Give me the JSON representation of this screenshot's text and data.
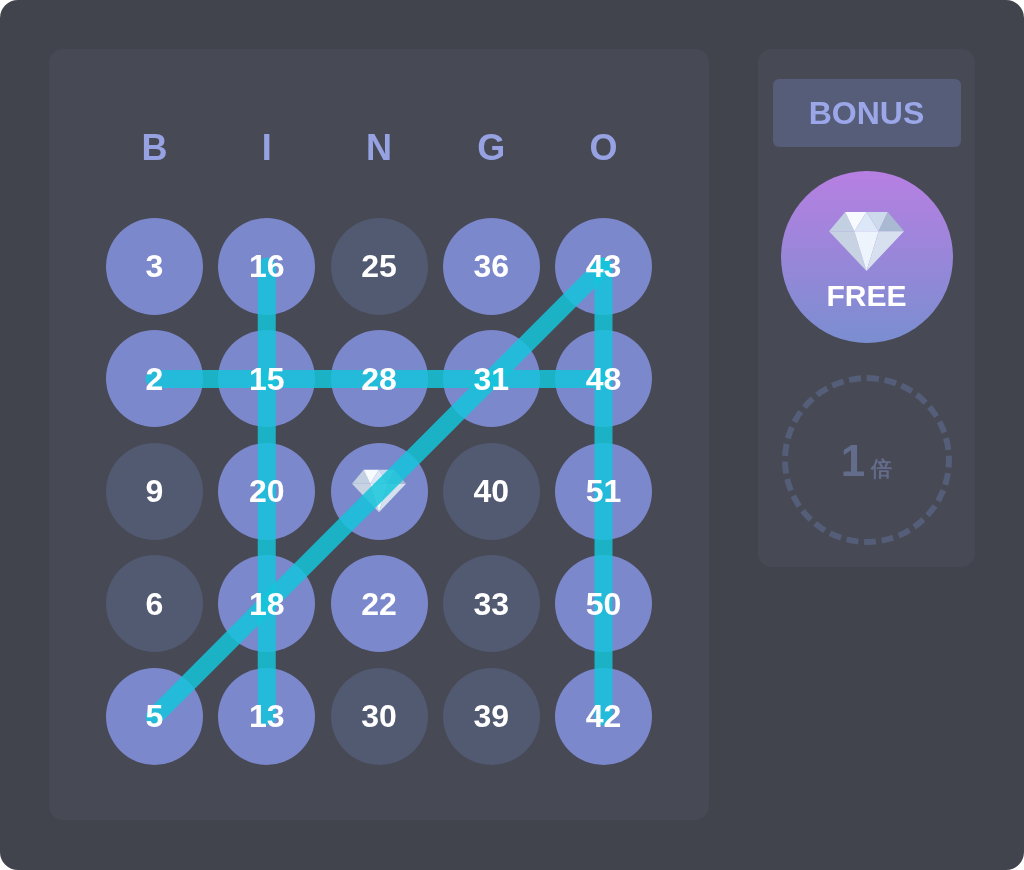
{
  "card": {
    "column_letters": [
      "B",
      "I",
      "N",
      "G",
      "O"
    ],
    "rows": [
      {
        "cells": [
          {
            "kind": "number",
            "number": "3",
            "marked": true
          },
          {
            "kind": "number",
            "number": "16",
            "marked": true
          },
          {
            "kind": "number",
            "number": "25",
            "marked": false
          },
          {
            "kind": "number",
            "number": "36",
            "marked": true
          },
          {
            "kind": "number",
            "number": "43",
            "marked": true
          }
        ]
      },
      {
        "cells": [
          {
            "kind": "number",
            "number": "2",
            "marked": true
          },
          {
            "kind": "number",
            "number": "15",
            "marked": true
          },
          {
            "kind": "number",
            "number": "28",
            "marked": true
          },
          {
            "kind": "number",
            "number": "31",
            "marked": true
          },
          {
            "kind": "number",
            "number": "48",
            "marked": true
          }
        ]
      },
      {
        "cells": [
          {
            "kind": "number",
            "number": "9",
            "marked": false
          },
          {
            "kind": "number",
            "number": "20",
            "marked": true
          },
          {
            "kind": "free",
            "marked": true
          },
          {
            "kind": "number",
            "number": "40",
            "marked": false
          },
          {
            "kind": "number",
            "number": "51",
            "marked": true
          }
        ]
      },
      {
        "cells": [
          {
            "kind": "number",
            "number": "6",
            "marked": false
          },
          {
            "kind": "number",
            "number": "18",
            "marked": true
          },
          {
            "kind": "number",
            "number": "22",
            "marked": true
          },
          {
            "kind": "number",
            "number": "33",
            "marked": false
          },
          {
            "kind": "number",
            "number": "50",
            "marked": true
          }
        ]
      },
      {
        "cells": [
          {
            "kind": "number",
            "number": "5",
            "marked": true
          },
          {
            "kind": "number",
            "number": "13",
            "marked": true
          },
          {
            "kind": "number",
            "number": "30",
            "marked": false
          },
          {
            "kind": "number",
            "number": "39",
            "marked": false
          },
          {
            "kind": "number",
            "number": "42",
            "marked": true
          }
        ]
      }
    ],
    "winning_lines": [
      {
        "kind": "column-2"
      },
      {
        "kind": "row-2"
      },
      {
        "kind": "column-5"
      },
      {
        "kind": "diagonal-up"
      }
    ]
  },
  "bonus": {
    "title": "BONUS",
    "free_spot": {
      "label": "FREE"
    },
    "multiplier": {
      "value": "1",
      "unit": "倍",
      "active": false
    }
  }
}
